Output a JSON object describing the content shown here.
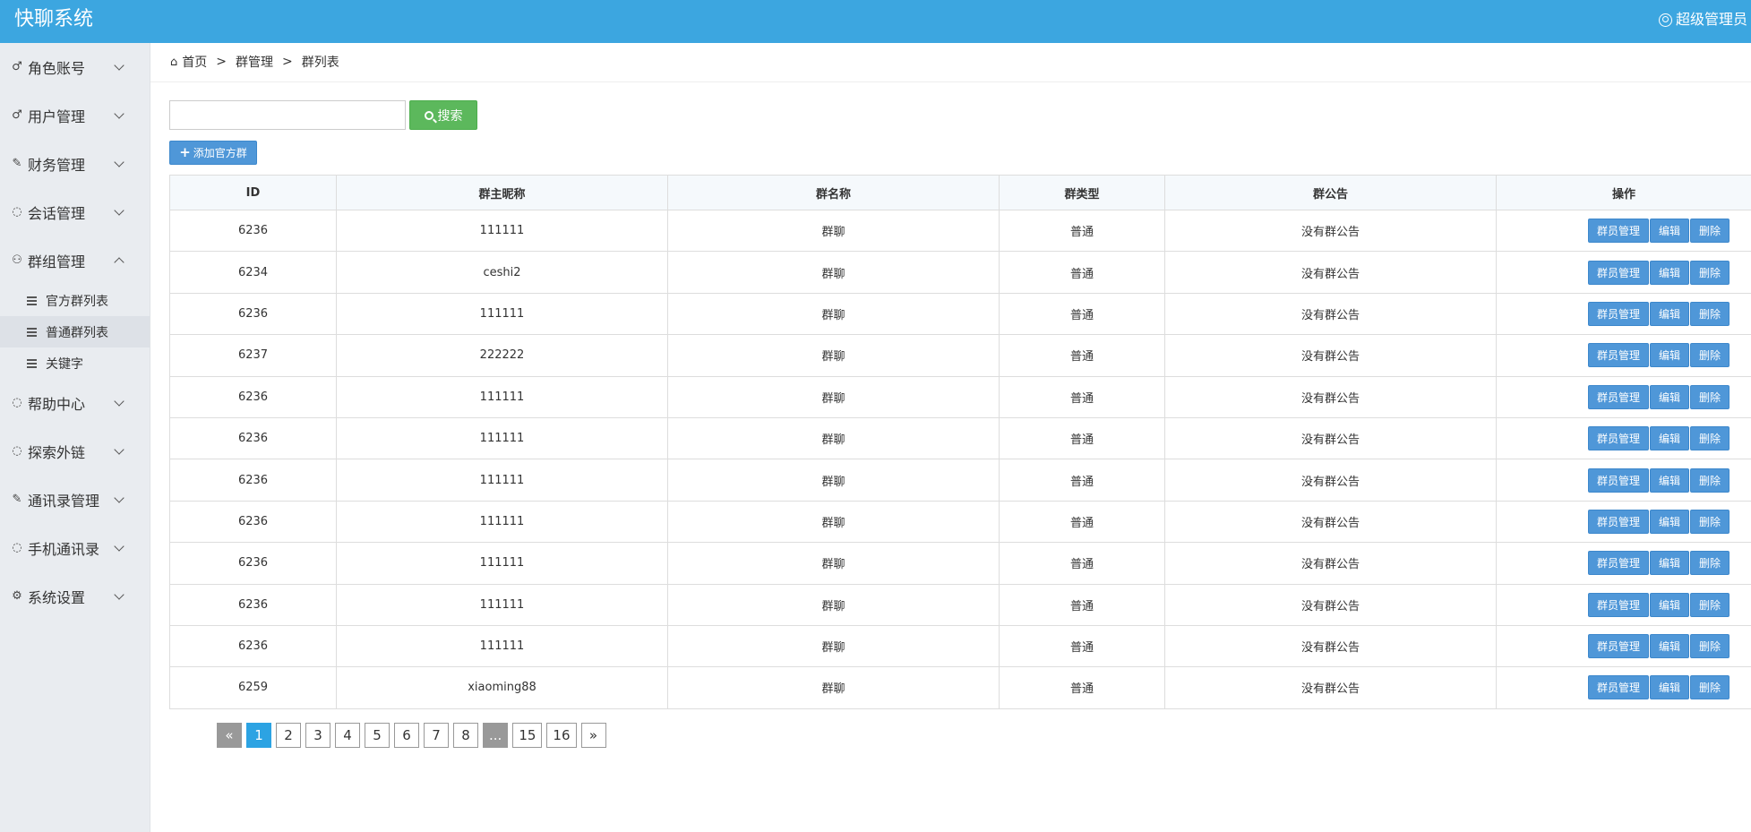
{
  "app": {
    "title": "快聊系统",
    "user": "超级管理员"
  },
  "sidebar": {
    "items": [
      {
        "label": "角色账号",
        "icon": "user-icon",
        "expanded": false
      },
      {
        "label": "用户管理",
        "icon": "user-icon",
        "expanded": false
      },
      {
        "label": "财务管理",
        "icon": "edit-icon",
        "expanded": false
      },
      {
        "label": "会话管理",
        "icon": "chat-icon",
        "expanded": false
      },
      {
        "label": "群组管理",
        "icon": "group-icon",
        "expanded": true,
        "children": [
          {
            "label": "官方群列表",
            "active": false
          },
          {
            "label": "普通群列表",
            "active": true
          },
          {
            "label": "关键字",
            "active": false
          }
        ]
      },
      {
        "label": "帮助中心",
        "icon": "chat-icon",
        "expanded": false
      },
      {
        "label": "探索外链",
        "icon": "chat-icon",
        "expanded": false
      },
      {
        "label": "通讯录管理",
        "icon": "edit-icon",
        "expanded": false
      },
      {
        "label": "手机通讯录",
        "icon": "chat-icon",
        "expanded": false
      },
      {
        "label": "系统设置",
        "icon": "gear-icon",
        "expanded": false
      }
    ]
  },
  "breadcrumb": {
    "home": "首页",
    "level1": "群管理",
    "level2": "群列表"
  },
  "search": {
    "value": "",
    "placeholder": "",
    "button": "搜索"
  },
  "toolbar": {
    "add_label": "添加官方群"
  },
  "table": {
    "headers": {
      "id": "ID",
      "owner": "群主昵称",
      "name": "群名称",
      "type": "群类型",
      "notice": "群公告",
      "ops": "操作"
    },
    "ops": {
      "members": "群员管理",
      "edit": "编辑",
      "delete": "删除"
    },
    "rows": [
      {
        "id": "6236",
        "owner": "111111",
        "name": "群聊",
        "type": "普通",
        "notice": "没有群公告"
      },
      {
        "id": "6234",
        "owner": "ceshi2",
        "name": "群聊",
        "type": "普通",
        "notice": "没有群公告"
      },
      {
        "id": "6236",
        "owner": "111111",
        "name": "群聊",
        "type": "普通",
        "notice": "没有群公告"
      },
      {
        "id": "6237",
        "owner": "222222",
        "name": "群聊",
        "type": "普通",
        "notice": "没有群公告"
      },
      {
        "id": "6236",
        "owner": "111111",
        "name": "群聊",
        "type": "普通",
        "notice": "没有群公告"
      },
      {
        "id": "6236",
        "owner": "111111",
        "name": "群聊",
        "type": "普通",
        "notice": "没有群公告"
      },
      {
        "id": "6236",
        "owner": "111111",
        "name": "群聊",
        "type": "普通",
        "notice": "没有群公告"
      },
      {
        "id": "6236",
        "owner": "111111",
        "name": "群聊",
        "type": "普通",
        "notice": "没有群公告"
      },
      {
        "id": "6236",
        "owner": "111111",
        "name": "群聊",
        "type": "普通",
        "notice": "没有群公告"
      },
      {
        "id": "6236",
        "owner": "111111",
        "name": "群聊",
        "type": "普通",
        "notice": "没有群公告"
      },
      {
        "id": "6236",
        "owner": "111111",
        "name": "群聊",
        "type": "普通",
        "notice": "没有群公告"
      },
      {
        "id": "6259",
        "owner": "xiaoming88",
        "name": "群聊",
        "type": "普通",
        "notice": "没有群公告"
      }
    ]
  },
  "pagination": {
    "prev": "«",
    "next": "»",
    "pages": [
      "1",
      "2",
      "3",
      "4",
      "5",
      "6",
      "7",
      "8",
      "...",
      "15",
      "16"
    ],
    "current": "1"
  },
  "colors": {
    "topbar": "#3ca6e0",
    "search_button": "#5cb85c",
    "action_button": "#4f97d8",
    "active_page": "#2ca3e3"
  }
}
